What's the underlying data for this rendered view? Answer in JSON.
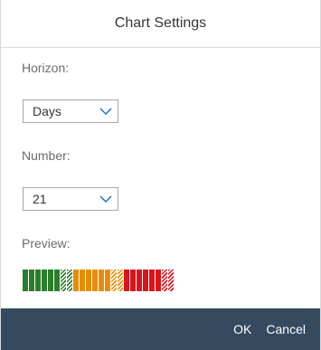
{
  "dialog": {
    "title": "Chart Settings"
  },
  "horizon": {
    "label": "Horizon:",
    "value": "Days"
  },
  "number": {
    "label": "Number:",
    "value": "21"
  },
  "preview": {
    "label": "Preview:",
    "segments": [
      "green",
      "green",
      "green",
      "green",
      "green",
      "green",
      "green-hatched",
      "green-hatched",
      "orange",
      "orange",
      "orange",
      "orange",
      "orange",
      "orange",
      "orange-hatched",
      "orange-hatched",
      "red",
      "red",
      "red",
      "red",
      "red",
      "red",
      "red-hatched",
      "red-hatched"
    ],
    "colors": {
      "green": "#2b7d2b",
      "orange": "#e78c07",
      "red": "#d9141b"
    }
  },
  "footer": {
    "ok_label": "OK",
    "cancel_label": "Cancel",
    "background": "#354a5f"
  },
  "icons": {
    "select_arrow": "chevron-down-icon"
  }
}
